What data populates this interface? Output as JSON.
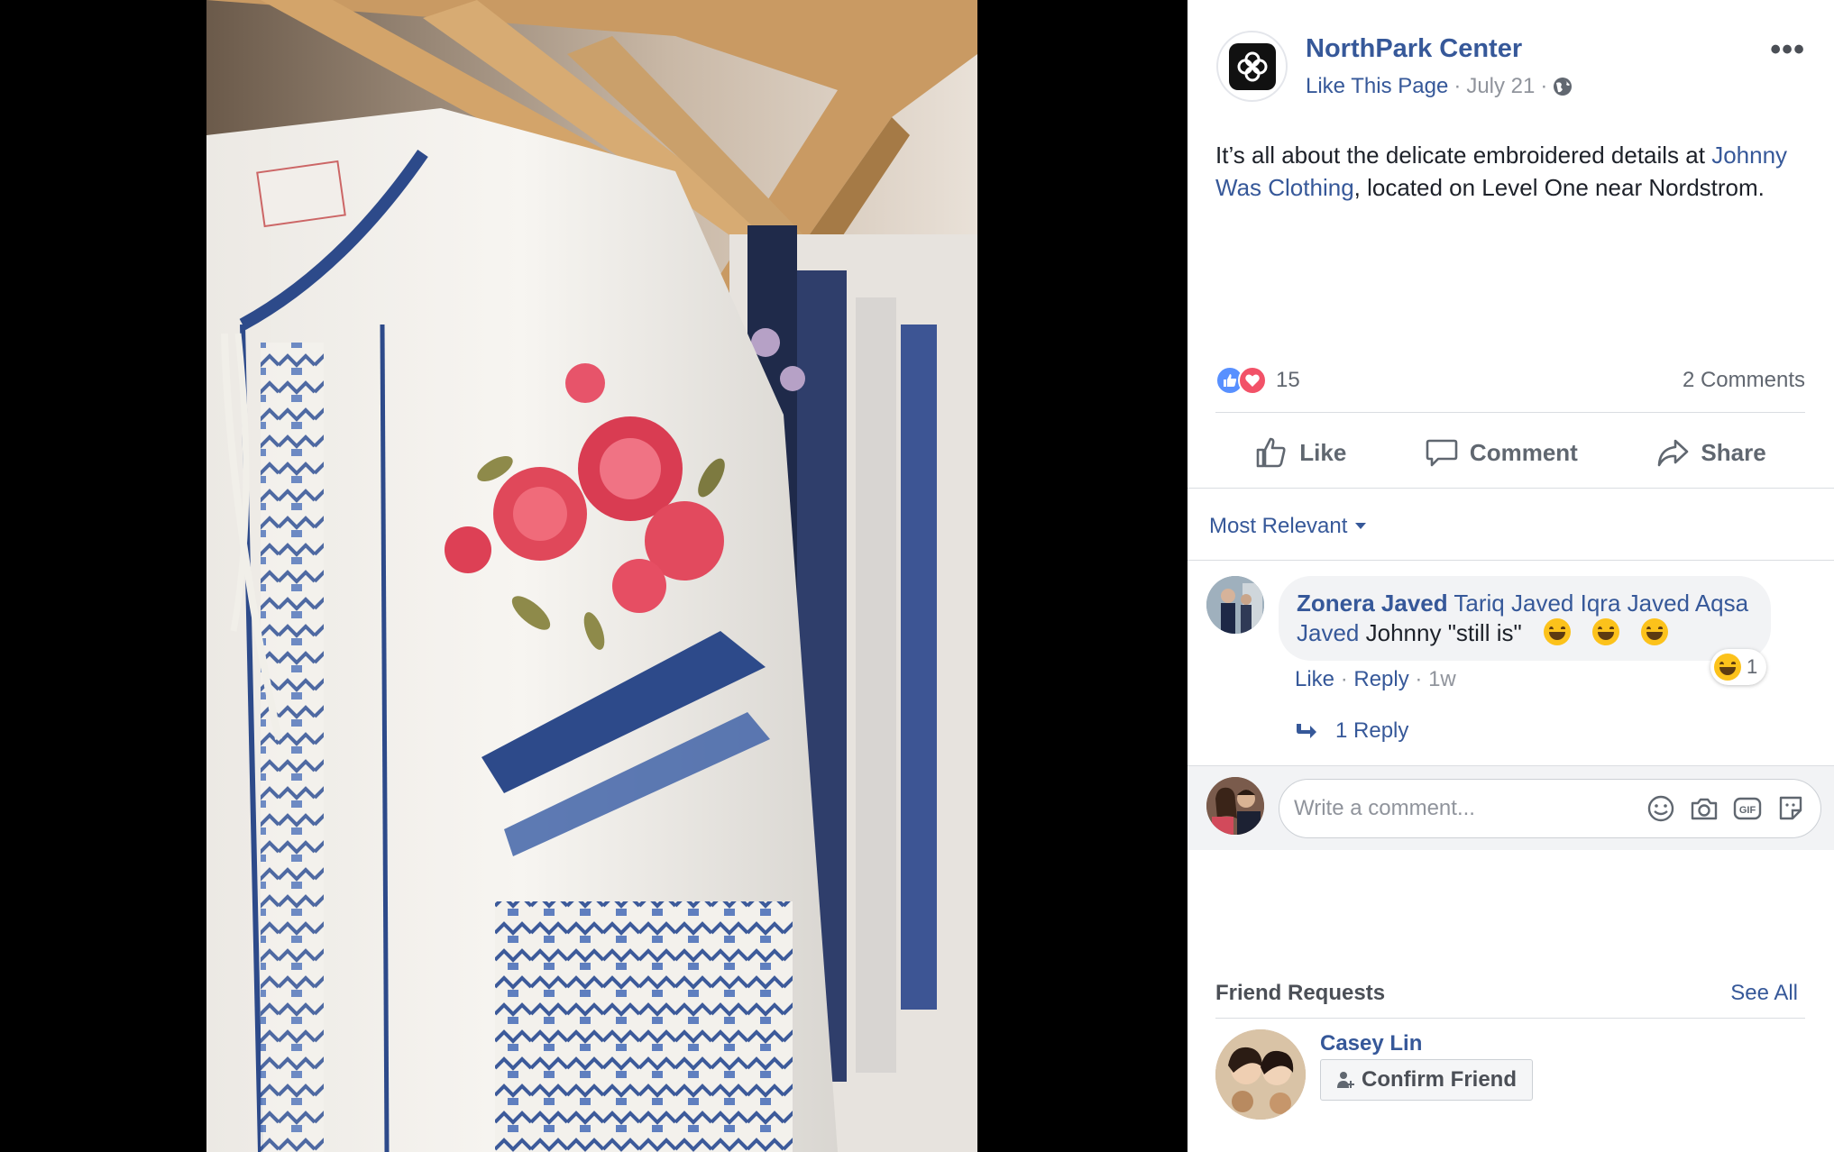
{
  "post": {
    "page_name": "NorthPark Center",
    "like_page": "Like This Page",
    "separator": "·",
    "date": "July 21",
    "privacy_icon": "globe-icon",
    "more_icon": "more-options-icon",
    "text_before": "It’s all about the delicate embroidered details at ",
    "text_link": "Johnny Was Clothing",
    "text_after": ", located on Level One near Nordstrom."
  },
  "reactions": {
    "icons": [
      "like-reaction-icon",
      "love-reaction-icon"
    ],
    "count": "15",
    "comments_count": "2 Comments"
  },
  "actions": {
    "like": "Like",
    "comment": "Comment",
    "share": "Share"
  },
  "comments": {
    "sort_label": "Most Relevant",
    "items": [
      {
        "author": "Zonera Javed",
        "tag_1": "Tariq Javed",
        "tag_2": "Iqra Javed",
        "tag_3": "Aqsa Javed",
        "text": "Johnny \"still is\"",
        "emoji": "tears-of-joy-emoji",
        "reaction_icon": "haha-reaction-icon",
        "reaction_count": "1",
        "like": "Like",
        "reply": "Reply",
        "time": "1w",
        "replies_label": "1 Reply"
      }
    ],
    "compose_placeholder": "Write a comment...",
    "compose_icons": [
      "emoji-icon",
      "camera-icon",
      "gif-icon",
      "sticker-icon"
    ]
  },
  "friend_requests": {
    "title": "Friend Requests",
    "see_all": "See All",
    "items": [
      {
        "name": "Casey Lin",
        "button": "Confirm Friend"
      }
    ]
  },
  "colors": {
    "link": "#365899",
    "muted": "#90949c",
    "like_blue": "#5890ff",
    "love_red": "#f25268",
    "background": "#000000"
  }
}
